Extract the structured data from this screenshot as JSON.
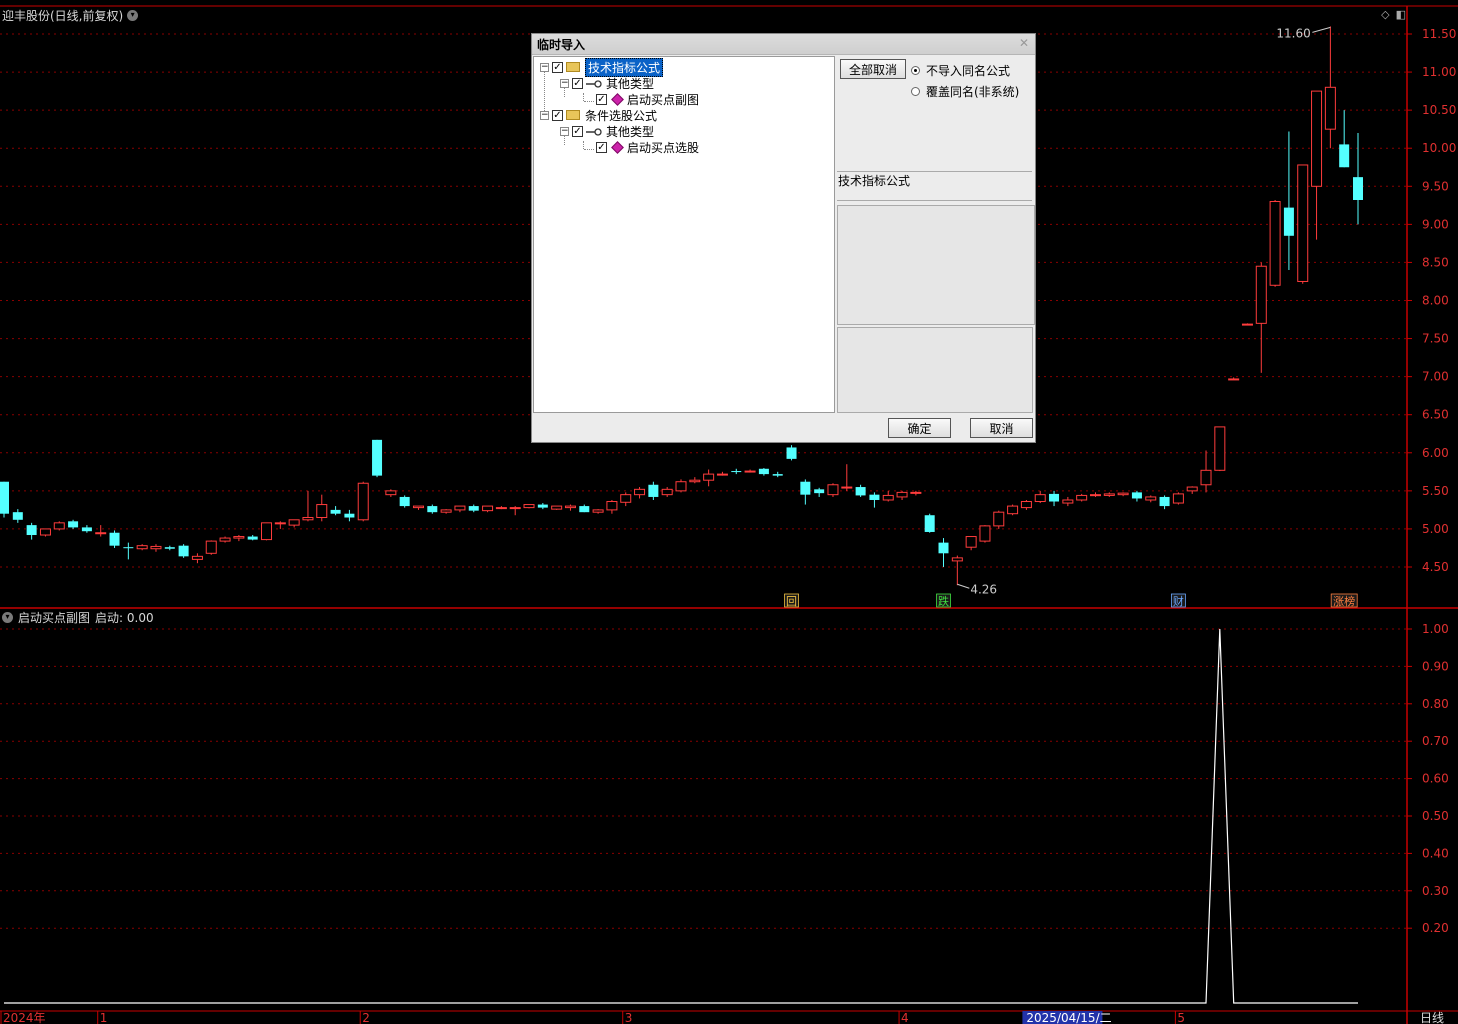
{
  "window": {
    "title": "迎丰股份(日线,前复权)",
    "period_label": "日线"
  },
  "price_axis": {
    "ticks": [
      "11.50",
      "11.00",
      "10.50",
      "10.00",
      "9.50",
      "9.00",
      "8.50",
      "8.00",
      "7.50",
      "7.00",
      "6.50",
      "6.00",
      "5.50",
      "5.00",
      "4.50"
    ]
  },
  "indicator_axis": {
    "ticks": [
      "1.00",
      "0.90",
      "0.80",
      "0.70",
      "0.60",
      "0.50",
      "0.40",
      "0.30",
      "0.20"
    ]
  },
  "x_axis": {
    "labels": [
      "2024年",
      "1",
      "2",
      "3",
      "4",
      "5"
    ],
    "cursor_date": "2025/04/15/二"
  },
  "annotations": {
    "high": "11.60",
    "low": "4.26"
  },
  "event_marks": [
    {
      "text": "回",
      "color": "#f0c040"
    },
    {
      "text": "跌",
      "color": "#40e040"
    },
    {
      "text": "财",
      "color": "#6aa8ff"
    },
    {
      "text": "涨榜",
      "color": "#ff8040"
    }
  ],
  "indicator": {
    "name": "启动买点副图",
    "value_label": "启动: 0.00"
  },
  "colors": {
    "up": "#ff3c3c",
    "down": "#54ffff",
    "grid": "#8a0000",
    "axis": "#c80000",
    "axis_text": "#e03030"
  },
  "chart_data": {
    "type": "candlestick",
    "title": "迎丰股份(日线,前复权)",
    "candles": [
      {
        "o": 5.62,
        "h": 5.62,
        "l": 5.15,
        "c": 5.2
      },
      {
        "o": 5.22,
        "h": 5.26,
        "l": 5.08,
        "c": 5.12
      },
      {
        "o": 5.05,
        "h": 5.08,
        "l": 4.86,
        "c": 4.92
      },
      {
        "o": 4.92,
        "h": 5.0,
        "l": 4.9,
        "c": 5.0
      },
      {
        "o": 5.0,
        "h": 5.1,
        "l": 4.98,
        "c": 5.08
      },
      {
        "o": 5.1,
        "h": 5.12,
        "l": 5.0,
        "c": 5.02
      },
      {
        "o": 5.02,
        "h": 5.05,
        "l": 4.95,
        "c": 4.97
      },
      {
        "o": 4.95,
        "h": 5.05,
        "l": 4.9,
        "c": 4.95
      },
      {
        "o": 4.95,
        "h": 4.98,
        "l": 4.75,
        "c": 4.78
      },
      {
        "o": 4.76,
        "h": 4.82,
        "l": 4.6,
        "c": 4.75
      },
      {
        "o": 4.74,
        "h": 4.8,
        "l": 4.72,
        "c": 4.78
      },
      {
        "o": 4.74,
        "h": 4.8,
        "l": 4.7,
        "c": 4.77
      },
      {
        "o": 4.76,
        "h": 4.78,
        "l": 4.72,
        "c": 4.74
      },
      {
        "o": 4.78,
        "h": 4.8,
        "l": 4.62,
        "c": 4.64
      },
      {
        "o": 4.6,
        "h": 4.68,
        "l": 4.55,
        "c": 4.64
      },
      {
        "o": 4.68,
        "h": 4.85,
        "l": 4.66,
        "c": 4.84
      },
      {
        "o": 4.84,
        "h": 4.9,
        "l": 4.82,
        "c": 4.88
      },
      {
        "o": 4.88,
        "h": 4.92,
        "l": 4.84,
        "c": 4.9
      },
      {
        "o": 4.9,
        "h": 4.92,
        "l": 4.85,
        "c": 4.86
      },
      {
        "o": 4.86,
        "h": 5.08,
        "l": 4.85,
        "c": 5.08
      },
      {
        "o": 5.08,
        "h": 5.1,
        "l": 5.0,
        "c": 5.08
      },
      {
        "o": 5.05,
        "h": 5.12,
        "l": 5.02,
        "c": 5.12
      },
      {
        "o": 5.12,
        "h": 5.5,
        "l": 5.1,
        "c": 5.15
      },
      {
        "o": 5.15,
        "h": 5.45,
        "l": 5.1,
        "c": 5.32
      },
      {
        "o": 5.25,
        "h": 5.3,
        "l": 5.18,
        "c": 5.2
      },
      {
        "o": 5.2,
        "h": 5.25,
        "l": 5.1,
        "c": 5.15
      },
      {
        "o": 5.12,
        "h": 5.62,
        "l": 5.1,
        "c": 5.6
      },
      {
        "o": 6.17,
        "h": 6.17,
        "l": 5.68,
        "c": 5.7
      },
      {
        "o": 5.45,
        "h": 5.52,
        "l": 5.42,
        "c": 5.5
      },
      {
        "o": 5.42,
        "h": 5.44,
        "l": 5.28,
        "c": 5.3
      },
      {
        "o": 5.28,
        "h": 5.3,
        "l": 5.25,
        "c": 5.3
      },
      {
        "o": 5.3,
        "h": 5.32,
        "l": 5.2,
        "c": 5.22
      },
      {
        "o": 5.22,
        "h": 5.26,
        "l": 5.2,
        "c": 5.25
      },
      {
        "o": 5.25,
        "h": 5.3,
        "l": 5.22,
        "c": 5.3
      },
      {
        "o": 5.3,
        "h": 5.32,
        "l": 5.22,
        "c": 5.24
      },
      {
        "o": 5.24,
        "h": 5.3,
        "l": 5.22,
        "c": 5.3
      },
      {
        "o": 5.28,
        "h": 5.3,
        "l": 5.26,
        "c": 5.28
      },
      {
        "o": 5.28,
        "h": 5.3,
        "l": 5.18,
        "c": 5.28
      },
      {
        "o": 5.28,
        "h": 5.32,
        "l": 5.27,
        "c": 5.32
      },
      {
        "o": 5.32,
        "h": 5.34,
        "l": 5.26,
        "c": 5.28
      },
      {
        "o": 5.26,
        "h": 5.3,
        "l": 5.25,
        "c": 5.3
      },
      {
        "o": 5.28,
        "h": 5.32,
        "l": 5.24,
        "c": 5.3
      },
      {
        "o": 5.3,
        "h": 5.32,
        "l": 5.22,
        "c": 5.22
      },
      {
        "o": 5.22,
        "h": 5.26,
        "l": 5.2,
        "c": 5.25
      },
      {
        "o": 5.25,
        "h": 5.38,
        "l": 5.2,
        "c": 5.36
      },
      {
        "o": 5.35,
        "h": 5.48,
        "l": 5.3,
        "c": 5.45
      },
      {
        "o": 5.45,
        "h": 5.55,
        "l": 5.4,
        "c": 5.52
      },
      {
        "o": 5.58,
        "h": 5.62,
        "l": 5.38,
        "c": 5.42
      },
      {
        "o": 5.45,
        "h": 5.55,
        "l": 5.42,
        "c": 5.52
      },
      {
        "o": 5.5,
        "h": 5.65,
        "l": 5.48,
        "c": 5.62
      },
      {
        "o": 5.62,
        "h": 5.68,
        "l": 5.6,
        "c": 5.64
      },
      {
        "o": 5.64,
        "h": 5.78,
        "l": 5.56,
        "c": 5.72
      },
      {
        "o": 5.72,
        "h": 5.75,
        "l": 5.7,
        "c": 5.72
      },
      {
        "o": 5.76,
        "h": 5.79,
        "l": 5.72,
        "c": 5.75
      },
      {
        "o": 5.76,
        "h": 5.78,
        "l": 5.74,
        "c": 5.76
      },
      {
        "o": 5.79,
        "h": 5.8,
        "l": 5.7,
        "c": 5.72
      },
      {
        "o": 5.72,
        "h": 5.75,
        "l": 5.68,
        "c": 5.7
      },
      {
        "o": 6.07,
        "h": 6.1,
        "l": 5.9,
        "c": 5.92
      },
      {
        "o": 5.62,
        "h": 5.65,
        "l": 5.32,
        "c": 5.45
      },
      {
        "o": 5.52,
        "h": 5.54,
        "l": 5.42,
        "c": 5.47
      },
      {
        "o": 5.45,
        "h": 5.6,
        "l": 5.42,
        "c": 5.58
      },
      {
        "o": 5.55,
        "h": 5.85,
        "l": 5.5,
        "c": 5.55
      },
      {
        "o": 5.55,
        "h": 5.58,
        "l": 5.42,
        "c": 5.44
      },
      {
        "o": 5.45,
        "h": 5.48,
        "l": 5.28,
        "c": 5.38
      },
      {
        "o": 5.38,
        "h": 5.5,
        "l": 5.36,
        "c": 5.44
      },
      {
        "o": 5.42,
        "h": 5.5,
        "l": 5.38,
        "c": 5.48
      },
      {
        "o": 5.48,
        "h": 5.5,
        "l": 5.44,
        "c": 5.48
      },
      {
        "o": 5.18,
        "h": 5.2,
        "l": 4.95,
        "c": 4.96
      },
      {
        "o": 4.82,
        "h": 4.88,
        "l": 4.5,
        "c": 4.68
      },
      {
        "o": 4.58,
        "h": 4.65,
        "l": 4.26,
        "c": 4.62
      },
      {
        "o": 4.76,
        "h": 4.9,
        "l": 4.72,
        "c": 4.9
      },
      {
        "o": 4.84,
        "h": 5.05,
        "l": 4.82,
        "c": 5.04
      },
      {
        "o": 5.04,
        "h": 5.24,
        "l": 5.0,
        "c": 5.22
      },
      {
        "o": 5.2,
        "h": 5.32,
        "l": 5.18,
        "c": 5.3
      },
      {
        "o": 5.28,
        "h": 5.38,
        "l": 5.25,
        "c": 5.36
      },
      {
        "o": 5.36,
        "h": 5.5,
        "l": 5.34,
        "c": 5.45
      },
      {
        "o": 5.46,
        "h": 5.5,
        "l": 5.3,
        "c": 5.36
      },
      {
        "o": 5.34,
        "h": 5.42,
        "l": 5.3,
        "c": 5.38
      },
      {
        "o": 5.38,
        "h": 5.46,
        "l": 5.36,
        "c": 5.44
      },
      {
        "o": 5.44,
        "h": 5.48,
        "l": 5.42,
        "c": 5.45
      },
      {
        "o": 5.44,
        "h": 5.48,
        "l": 5.42,
        "c": 5.46
      },
      {
        "o": 5.45,
        "h": 5.48,
        "l": 5.43,
        "c": 5.47
      },
      {
        "o": 5.48,
        "h": 5.5,
        "l": 5.36,
        "c": 5.4
      },
      {
        "o": 5.38,
        "h": 5.44,
        "l": 5.35,
        "c": 5.42
      },
      {
        "o": 5.42,
        "h": 5.44,
        "l": 5.26,
        "c": 5.3
      },
      {
        "o": 5.34,
        "h": 5.48,
        "l": 5.32,
        "c": 5.46
      },
      {
        "o": 5.5,
        "h": 5.56,
        "l": 5.46,
        "c": 5.55
      },
      {
        "o": 5.58,
        "h": 6.03,
        "l": 5.48,
        "c": 5.77
      },
      {
        "o": 5.77,
        "h": 6.34,
        "l": 5.76,
        "c": 6.34
      },
      {
        "o": 6.97,
        "h": 6.99,
        "l": 6.97,
        "c": 6.97
      },
      {
        "o": 7.68,
        "h": 7.7,
        "l": 7.68,
        "c": 7.69
      },
      {
        "o": 7.7,
        "h": 8.5,
        "l": 7.05,
        "c": 8.45
      },
      {
        "o": 8.2,
        "h": 9.32,
        "l": 8.18,
        "c": 9.3
      },
      {
        "o": 9.22,
        "h": 10.22,
        "l": 8.4,
        "c": 8.85
      },
      {
        "o": 8.25,
        "h": 9.78,
        "l": 8.22,
        "c": 9.78
      },
      {
        "o": 9.5,
        "h": 10.75,
        "l": 8.8,
        "c": 10.75
      },
      {
        "o": 10.25,
        "h": 11.6,
        "l": 10.0,
        "c": 10.8
      },
      {
        "o": 10.05,
        "h": 10.5,
        "l": 9.75,
        "c": 9.75
      },
      {
        "o": 9.62,
        "h": 10.2,
        "l": 9.0,
        "c": 9.32
      }
    ],
    "indicator_series": {
      "name": "启动",
      "values": [
        0,
        0,
        0,
        0,
        0,
        0,
        0,
        0,
        0,
        0,
        0,
        0,
        0,
        0,
        0,
        0,
        0,
        0,
        0,
        0,
        0,
        0,
        0,
        0,
        0,
        0,
        0,
        0,
        0,
        0,
        0,
        0,
        0,
        0,
        0,
        0,
        0,
        0,
        0,
        0,
        0,
        0,
        0,
        0,
        0,
        0,
        0,
        0,
        0,
        0,
        0,
        0,
        0,
        0,
        0,
        0,
        0,
        0,
        0,
        0,
        0,
        0,
        0,
        0,
        0,
        0,
        0,
        0,
        0,
        0,
        0,
        0,
        0,
        0,
        0,
        0,
        0,
        0,
        0,
        0,
        0,
        0,
        0,
        0,
        0,
        0,
        0,
        0,
        1,
        0,
        0,
        0,
        0,
        0,
        0,
        0,
        0,
        0,
        0
      ]
    },
    "ylim_price": [
      4.26,
      11.6
    ],
    "ylim_indicator": [
      0,
      1.0
    ],
    "grid": true
  },
  "dialog": {
    "title": "临时导入",
    "tree": [
      {
        "label": "技术指标公式",
        "level": 0,
        "kind": "folder",
        "selected": true
      },
      {
        "label": "其他类型",
        "level": 1,
        "kind": "key"
      },
      {
        "label": "启动买点副图",
        "level": 2,
        "kind": "gem"
      },
      {
        "label": "条件选股公式",
        "level": 0,
        "kind": "folder"
      },
      {
        "label": "其他类型",
        "level": 1,
        "kind": "key"
      },
      {
        "label": "启动买点选股",
        "level": 2,
        "kind": "gem"
      }
    ],
    "clear_all": "全部取消",
    "radio_no_import": "不导入同名公式",
    "radio_overwrite": "覆盖同名(非系统)",
    "info_label": "技术指标公式",
    "ok": "确定",
    "cancel": "取消"
  }
}
